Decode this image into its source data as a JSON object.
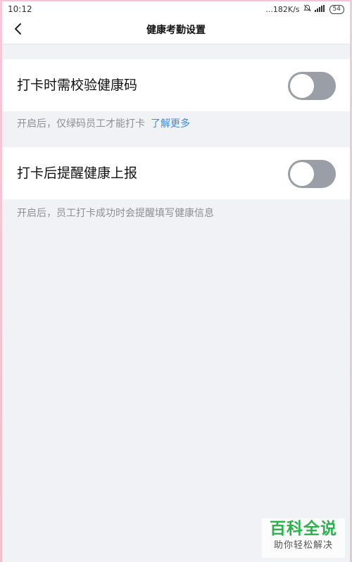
{
  "status_bar": {
    "time": "10:12",
    "network_speed": "...182K/s",
    "battery": "54",
    "icons": [
      "alarm-off-icon",
      "signal-icon",
      "battery-icon"
    ]
  },
  "header": {
    "title": "健康考勤设置",
    "back_icon": "chevron-left-icon"
  },
  "settings": [
    {
      "label": "打卡时需校验健康码",
      "enabled": false,
      "hint": "开启后，仅绿码员工才能打卡",
      "hint_link": "了解更多"
    },
    {
      "label": "打卡后提醒健康上报",
      "enabled": false,
      "hint": "开启后，员工打卡成功时会提醒填写健康信息"
    }
  ],
  "watermark": {
    "title": "百科全说",
    "subtitle": "助你轻松解决"
  },
  "colors": {
    "toggle_off": "#9a9ea6",
    "link": "#3d8be0",
    "background": "#f1f2f5",
    "watermark_green": "#2bb24c"
  }
}
